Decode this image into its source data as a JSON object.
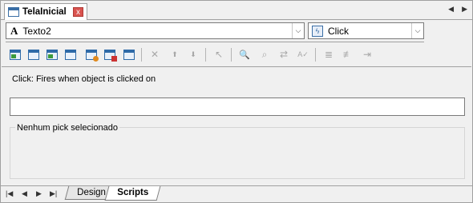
{
  "document_tab": {
    "title": "TelaInicial",
    "close_symbol": "x"
  },
  "tab_nav": {
    "prev": "◀",
    "next": "▶"
  },
  "object_combo": {
    "icon": "A",
    "value": "Texto2"
  },
  "event_combo": {
    "icon": "lightning-icon",
    "value": "Click"
  },
  "dropdown_arrow": "⌵",
  "toolbar": {
    "icons": [
      "new-script-icon",
      "insert-object-icon",
      "insert-image-icon",
      "insert-screen-icon",
      "import-icon",
      "settings-icon",
      "print-icon",
      "delete-icon",
      "move-up-icon",
      "move-down-icon",
      "pointer-icon",
      "find-icon",
      "find-next-icon",
      "replace-icon",
      "spell-check-icon",
      "comment-icon",
      "uncomment-icon",
      "indent-icon"
    ],
    "glyphs": {
      "delete": "✕",
      "move_up": "⬆",
      "move_down": "⬇",
      "pointer": "↖",
      "find": "🔍",
      "find_next": "⌕",
      "replace": "⇄",
      "spell_check": "A✓",
      "comment": "≣",
      "uncomment": "≢",
      "indent": "⇥"
    }
  },
  "event_description": "Click: Fires when object is clicked on",
  "pick_input": {
    "value": ""
  },
  "pick_group": {
    "label": "Nenhum pick selecionado"
  },
  "bottom_nav": {
    "first": "|◀",
    "prev": "◀",
    "next": "▶",
    "last": "▶|"
  },
  "bottom_tabs": [
    {
      "label": "Design",
      "active": false
    },
    {
      "label": "Scripts",
      "active": true
    }
  ],
  "colors": {
    "accent": "#2e6aa8",
    "close_button": "#d9534f"
  }
}
